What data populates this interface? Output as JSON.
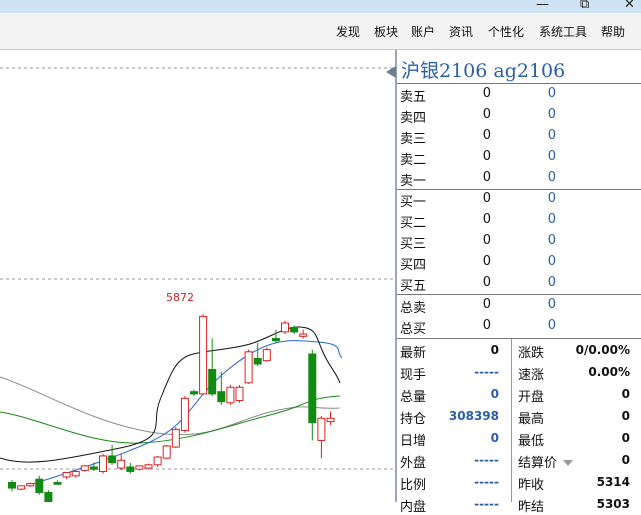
{
  "menu": {
    "items": [
      "发现",
      "板块",
      "账户",
      "资讯",
      "个性化",
      "系统工具",
      "帮助"
    ]
  },
  "chart": {
    "peak_label": "5872",
    "candles": [
      {
        "o": 5030,
        "h": 5040,
        "c": 5005,
        "l": 4990,
        "up": false
      },
      {
        "o": 5000,
        "h": 5010,
        "c": 5015,
        "l": 4995,
        "up": true
      },
      {
        "o": 5015,
        "h": 5030,
        "c": 5025,
        "l": 5010,
        "up": true
      },
      {
        "o": 5045,
        "h": 5060,
        "c": 4985,
        "l": 4975,
        "up": false
      },
      {
        "o": 4985,
        "h": 4995,
        "c": 4930,
        "l": 4915,
        "up": false
      },
      {
        "o": 5030,
        "h": 5040,
        "c": 5022,
        "l": 5018,
        "up": false
      },
      {
        "o": 5055,
        "h": 5070,
        "c": 5075,
        "l": 5045,
        "up": true
      },
      {
        "o": 5060,
        "h": 5085,
        "c": 5080,
        "l": 5052,
        "up": true
      },
      {
        "o": 5085,
        "h": 5110,
        "c": 5105,
        "l": 5078,
        "up": true
      },
      {
        "o": 5100,
        "h": 5120,
        "c": 5090,
        "l": 5082,
        "up": false
      },
      {
        "o": 5080,
        "h": 5160,
        "c": 5150,
        "l": 5070,
        "up": true
      },
      {
        "o": 5150,
        "h": 5200,
        "c": 5120,
        "l": 5110,
        "up": false
      },
      {
        "o": 5095,
        "h": 5160,
        "c": 5130,
        "l": 5085,
        "up": true
      },
      {
        "o": 5100,
        "h": 5118,
        "c": 5080,
        "l": 5070,
        "up": false
      },
      {
        "o": 5090,
        "h": 5108,
        "c": 5105,
        "l": 5085,
        "up": true
      },
      {
        "o": 5095,
        "h": 5115,
        "c": 5110,
        "l": 5090,
        "up": true
      },
      {
        "o": 5110,
        "h": 5150,
        "c": 5145,
        "l": 5100,
        "up": true
      },
      {
        "o": 5140,
        "h": 5200,
        "c": 5195,
        "l": 5135,
        "up": true
      },
      {
        "o": 5190,
        "h": 5280,
        "c": 5270,
        "l": 5185,
        "up": true
      },
      {
        "o": 5265,
        "h": 5420,
        "c": 5410,
        "l": 5255,
        "up": true
      },
      {
        "o": 5440,
        "h": 5450,
        "c": 5430,
        "l": 5420,
        "up": false
      },
      {
        "o": 5430,
        "h": 5790,
        "c": 5780,
        "l": 5425,
        "up": true
      },
      {
        "o": 5540,
        "h": 5680,
        "c": 5430,
        "l": 5420,
        "up": false
      },
      {
        "o": 5440,
        "h": 5530,
        "c": 5395,
        "l": 5380,
        "up": false
      },
      {
        "o": 5390,
        "h": 5470,
        "c": 5460,
        "l": 5380,
        "up": true
      },
      {
        "o": 5400,
        "h": 5470,
        "c": 5460,
        "l": 5390,
        "up": true
      },
      {
        "o": 5480,
        "h": 5630,
        "c": 5620,
        "l": 5475,
        "up": true
      },
      {
        "o": 5590,
        "h": 5660,
        "c": 5565,
        "l": 5555,
        "up": false
      },
      {
        "o": 5580,
        "h": 5640,
        "c": 5630,
        "l": 5575,
        "up": true
      },
      {
        "o": 5680,
        "h": 5720,
        "c": 5670,
        "l": 5660,
        "up": false
      },
      {
        "o": 5710,
        "h": 5760,
        "c": 5750,
        "l": 5700,
        "up": true
      },
      {
        "o": 5730,
        "h": 5740,
        "c": 5710,
        "l": 5700,
        "up": false
      },
      {
        "o": 5690,
        "h": 5720,
        "c": 5700,
        "l": 5680,
        "up": true
      },
      {
        "o": 5610,
        "h": 5630,
        "c": 5300,
        "l": 5220,
        "up": false
      },
      {
        "o": 5220,
        "h": 5330,
        "c": 5320,
        "l": 5140,
        "up": true
      },
      {
        "o": 5305,
        "h": 5350,
        "c": 5320,
        "l": 5290,
        "up": true
      }
    ]
  },
  "quote": {
    "title": "沪银2106  ag2106",
    "sell": [
      {
        "label": "卖五",
        "v1": "0",
        "v2": "0"
      },
      {
        "label": "卖四",
        "v1": "0",
        "v2": "0"
      },
      {
        "label": "卖三",
        "v1": "0",
        "v2": "0"
      },
      {
        "label": "卖二",
        "v1": "0",
        "v2": "0"
      },
      {
        "label": "卖一",
        "v1": "0",
        "v2": "0"
      }
    ],
    "buy": [
      {
        "label": "买一",
        "v1": "0",
        "v2": "0"
      },
      {
        "label": "买二",
        "v1": "0",
        "v2": "0"
      },
      {
        "label": "买三",
        "v1": "0",
        "v2": "0"
      },
      {
        "label": "买四",
        "v1": "0",
        "v2": "0"
      },
      {
        "label": "买五",
        "v1": "0",
        "v2": "0"
      }
    ],
    "totals": [
      {
        "label": "总卖",
        "v1": "0",
        "v2": "0"
      },
      {
        "label": "总买",
        "v1": "0",
        "v2": "0"
      }
    ],
    "left_stats": [
      {
        "label": "最新",
        "value": "0",
        "color": "#111111"
      },
      {
        "label": "现手",
        "value": "-----",
        "color": "#2a5ea8"
      },
      {
        "label": "总量",
        "value": "0",
        "color": "#2a5ea8"
      },
      {
        "label": "持仓",
        "value": "308398",
        "color": "#2a5ea8"
      },
      {
        "label": "日增",
        "value": "0",
        "color": "#2a5ea8"
      },
      {
        "label": "外盘",
        "value": "-----",
        "color": "#2a5ea8"
      },
      {
        "label": "比例",
        "value": "-----",
        "color": "#2a5ea8"
      },
      {
        "label": "内盘",
        "value": "-----",
        "color": "#2a5ea8"
      }
    ],
    "right_stats": [
      {
        "label": "涨跌",
        "value": "0/0.00%",
        "color": "#111111"
      },
      {
        "label": "速涨",
        "value": "0.00%",
        "color": "#111111"
      },
      {
        "label": "开盘",
        "value": "0",
        "color": "#111111"
      },
      {
        "label": "最高",
        "value": "0",
        "color": "#111111"
      },
      {
        "label": "最低",
        "value": "0",
        "color": "#111111"
      },
      {
        "label": "结算价",
        "value": "0",
        "color": "#111111",
        "dropdown": true
      },
      {
        "label": "昨收",
        "value": "5314",
        "color": "#111111"
      },
      {
        "label": "昨结",
        "value": "5303",
        "color": "#111111"
      }
    ]
  }
}
